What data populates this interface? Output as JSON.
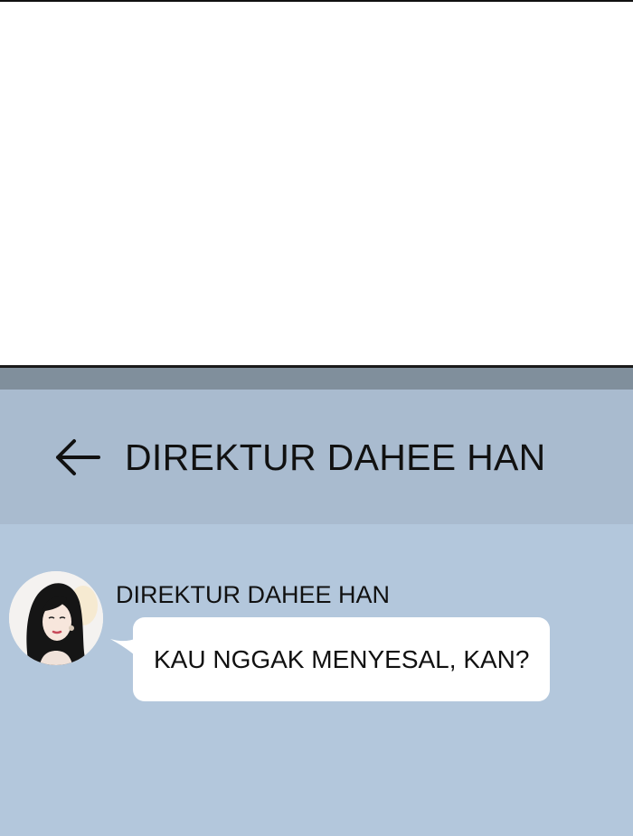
{
  "header": {
    "title": "DIREKTUR DAHEE HAN",
    "back_icon": "arrow-left-icon"
  },
  "conversation": {
    "sender_name": "DIREKTUR DAHEE HAN",
    "avatar_icon": "contact-avatar",
    "messages": [
      {
        "text": "KAU NGGAK MENYESAL, KAN?"
      }
    ]
  },
  "colors": {
    "status_strip": "#808f9c",
    "header_background": "#a9bbcf",
    "chat_background": "#b3c7dc",
    "bubble": "#ffffff",
    "text": "#111111"
  }
}
